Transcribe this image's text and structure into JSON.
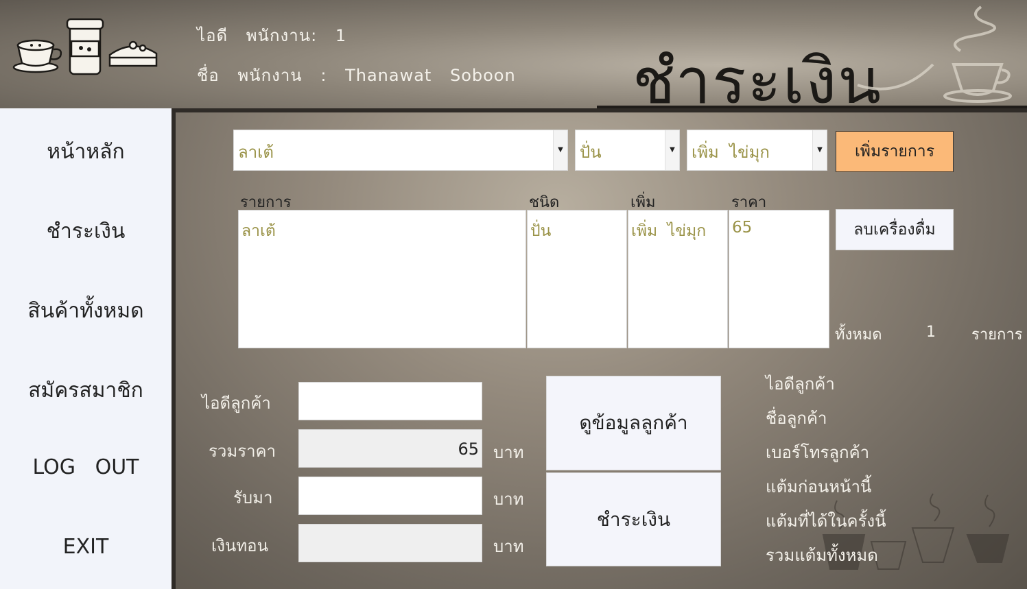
{
  "employee": {
    "id_label": "ไอดี",
    "id_label2": "พนักงาน:",
    "id_value": "1",
    "name_label": "ชื่อ",
    "name_label2": "พนักงาน",
    "name_sep": ":",
    "first_name": "Thanawat",
    "last_name": "Soboon"
  },
  "page_title": "ชำระเงิน",
  "sidebar": {
    "items": [
      {
        "label": "หน้าหลัก"
      },
      {
        "label": "ชำระเงิน"
      },
      {
        "label": "สินค้าทั้งหมด"
      },
      {
        "label": "สมัครสมาชิก"
      },
      {
        "label": "LOG   OUT"
      },
      {
        "label": "EXIT"
      }
    ]
  },
  "order": {
    "drink_select": "ลาเต้",
    "type_select": "ปั่น",
    "topping_select": "เพิ่ม  ไข่มุก",
    "add_button": "เพิ่มรายการ",
    "delete_button": "ลบเครื่องดื่ม",
    "columns": [
      "รายการ",
      "ชนิด",
      "เพิ่ม",
      "ราคา"
    ],
    "rows": [
      {
        "item": "ลาเต้",
        "type": "ปั่น",
        "extra": "เพิ่ม  ไข่มุก",
        "price": "65"
      }
    ],
    "total_label": "ทั้งหมด",
    "total_count": "1",
    "total_unit": "รายการ"
  },
  "payment": {
    "customer_id_label": "ไอดีลูกค้า",
    "customer_id_value": "",
    "total_price_label": "รวมราคา",
    "total_price_value": "65",
    "received_label": "รับมา",
    "received_value": "",
    "change_label": "เงินทอน",
    "change_value": "",
    "currency": "บาท",
    "view_customer_button": "ดูข้อมูลลูกค้า",
    "pay_button": "ชำระเงิน"
  },
  "customer_info": {
    "labels": [
      "ไอดีลูกค้า",
      "ชื่อลูกค้า",
      "เบอร์โทรลูกค้า",
      "แต้มก่อนหน้านี้",
      "แต้มที่ได้ในครั้งนี้",
      "รวมแต้มทั้งหมด"
    ]
  },
  "colors": {
    "add_button_bg": "#fbb978",
    "selected_text": "#9a9348",
    "sidebar_bg": "#f2f4fa"
  }
}
